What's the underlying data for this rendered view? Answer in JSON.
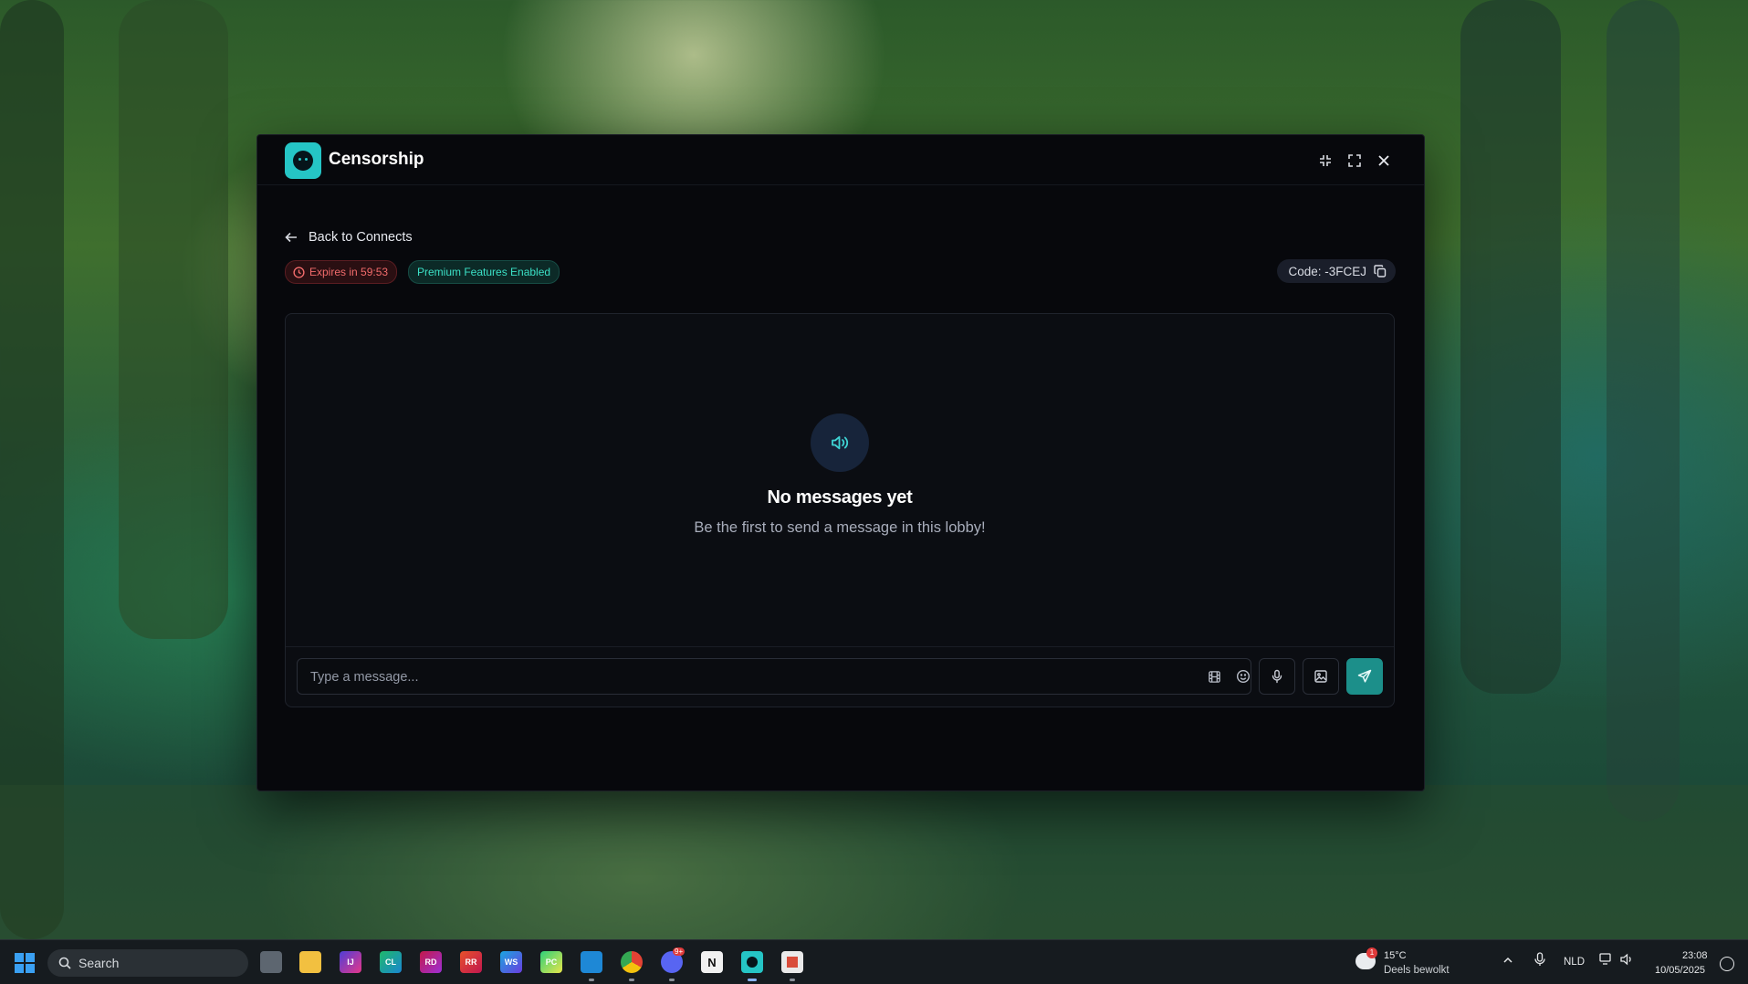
{
  "app": {
    "title": "Censorship"
  },
  "nav": {
    "back_label": "Back to Connects"
  },
  "status": {
    "expires": "Expires in 59:53",
    "premium": "Premium Features Enabled",
    "code": "Code: -3FCEJ"
  },
  "chat": {
    "empty_title": "No messages yet",
    "empty_subtitle": "Be the first to send a message in this lobby!",
    "input_placeholder": "Type a message..."
  },
  "taskbar": {
    "search_label": "Search",
    "weather_temp": "15°C",
    "weather_desc": "Deels bewolkt",
    "weather_badge": "1",
    "language": "NLD",
    "time": "23:08",
    "date": "10/05/2025",
    "discord_badge": "9+"
  },
  "colors": {
    "accent": "#25c5c5",
    "window_bg": "#07080c",
    "expire_red": "#f16b6b",
    "premium_teal": "#3be0c6",
    "send_button": "#1c8f8a"
  }
}
